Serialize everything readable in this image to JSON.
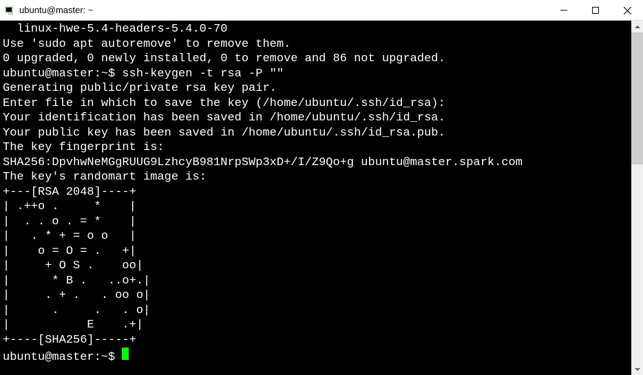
{
  "window": {
    "title": "ubuntu@master: ~"
  },
  "terminal": {
    "output": "  linux-hwe-5.4-headers-5.4.0-70\nUse 'sudo apt autoremove' to remove them.\n0 upgraded, 0 newly installed, 0 to remove and 86 not upgraded.\nubuntu@master:~$ ssh-keygen -t rsa -P \"\"\nGenerating public/private rsa key pair.\nEnter file in which to save the key (/home/ubuntu/.ssh/id_rsa):\nYour identification has been saved in /home/ubuntu/.ssh/id_rsa.\nYour public key has been saved in /home/ubuntu/.ssh/id_rsa.pub.\nThe key fingerprint is:\nSHA256:DpvhwNeMGgRUUG9LzhcyB981NrpSWp3xD+/I/Z9Qo+g ubuntu@master.spark.com\nThe key's randomart image is:\n+---[RSA 2048]----+\n| .++o .     *    |\n|  . . o . = *    |\n|   . * + = o o   |\n|    o = O = .   +|\n|     + O S .    oo|\n|      * B .   ..o+.|\n|     . + .   . oo o|\n|      .     .   . o|\n|           E    .+|\n+----[SHA256]-----+",
    "prompt": "ubuntu@master:~$ "
  }
}
